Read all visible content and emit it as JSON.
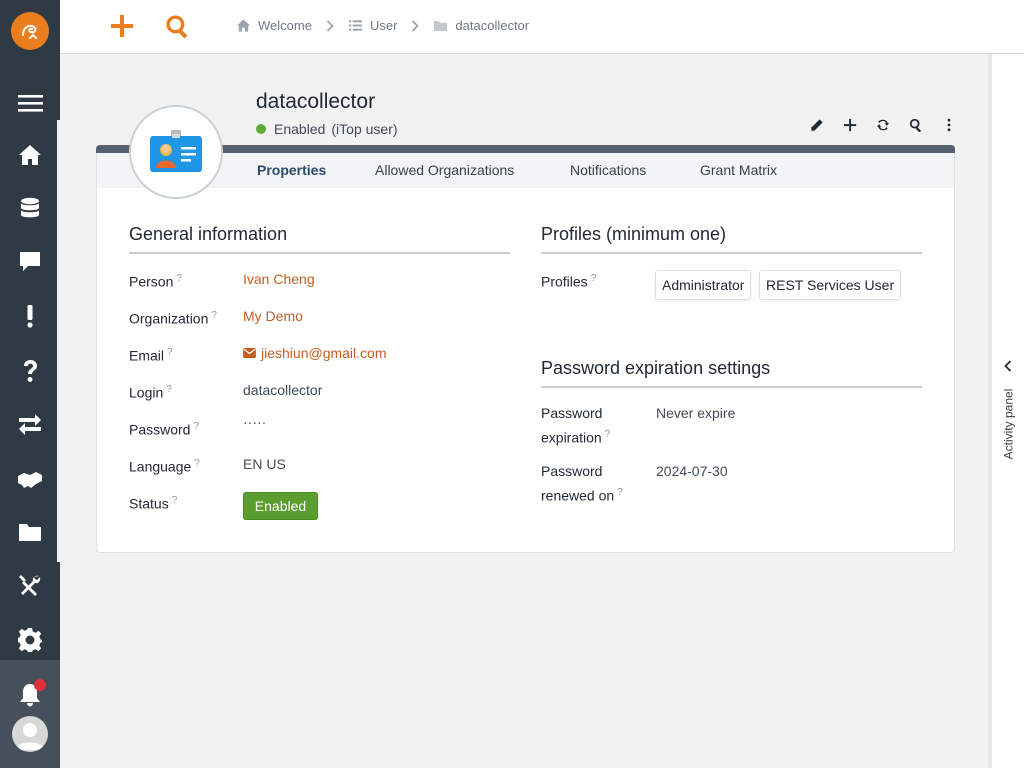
{
  "topbar": {
    "new_icon": "plus-icon",
    "search_icon": "search-icon"
  },
  "breadcrumbs": [
    {
      "label": "Welcome",
      "icon": "home-icon"
    },
    {
      "label": "User",
      "icon": "list-icon"
    },
    {
      "label": "datacollector",
      "icon": "folder-icon"
    }
  ],
  "nav": {
    "items": [
      "menu-icon",
      "home-icon",
      "database-icon",
      "chat-icon",
      "exclamation-icon",
      "question-icon",
      "exchange-icon",
      "handshake-icon",
      "folder-icon",
      "tools-icon",
      "gear-icon"
    ],
    "bottom": [
      "bell-icon",
      "avatar"
    ]
  },
  "object": {
    "title": "datacollector",
    "status": "Enabled",
    "status_class": "(iTop user)",
    "status_color": "#5eaa3c"
  },
  "tabs": [
    {
      "label": "Properties",
      "active": true
    },
    {
      "label": "Allowed Organizations",
      "active": false
    },
    {
      "label": "Notifications",
      "active": false
    },
    {
      "label": "Grant Matrix",
      "active": false
    }
  ],
  "general": {
    "title": "General information",
    "person_label": "Person",
    "person_value": "Ivan Cheng",
    "organization_label": "Organization",
    "organization_value": "My Demo",
    "email_label": "Email",
    "email_value": "jieshiun@gmail.com",
    "login_label": "Login",
    "login_value": "datacollector",
    "password_label": "Password",
    "password_value": "·····",
    "language_label": "Language",
    "language_value": "EN US",
    "status_label": "Status",
    "status_value": "Enabled",
    "help_mark": "?"
  },
  "profiles": {
    "title": "Profiles (minimum one)",
    "label": "Profiles",
    "values": [
      "Administrator",
      "REST Services User"
    ]
  },
  "password_settings": {
    "title": "Password expiration settings",
    "expiration_label_1": "Password",
    "expiration_label_2": "expiration",
    "expiration_value": "Never expire",
    "renewed_label_1": "Password",
    "renewed_label_2": "renewed on",
    "renewed_value": "2024-07-30"
  },
  "activity_panel": {
    "label": "Activity panel"
  },
  "colors": {
    "brand": "#ea7d1e",
    "nav_bg": "#2f3a45",
    "link": "#c25e21",
    "enabled_badge": "#5a9e2f"
  }
}
